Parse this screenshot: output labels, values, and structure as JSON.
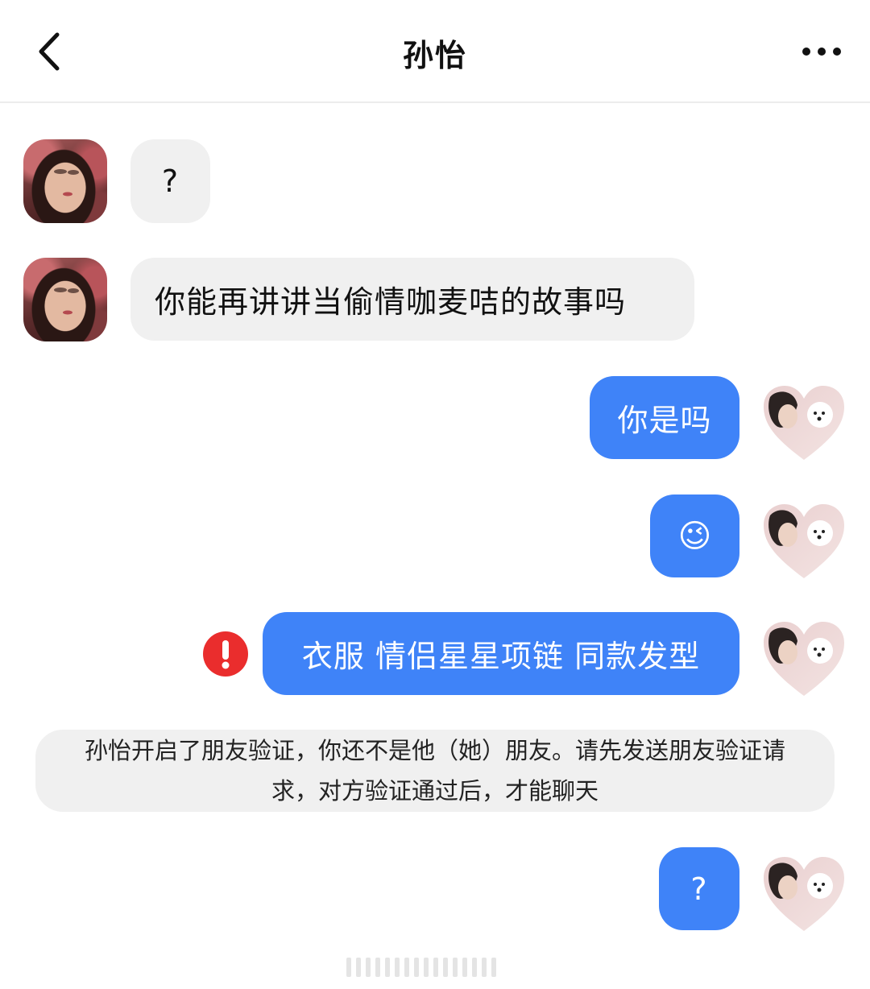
{
  "header": {
    "title": "孙怡",
    "back_icon": "chevron-left-icon",
    "more_icon": "more-horizontal-icon"
  },
  "messages": [
    {
      "side": "left",
      "text": "?"
    },
    {
      "side": "left",
      "text": "你能再讲讲当偷情咖麦咭的故事吗"
    },
    {
      "side": "right",
      "text": "你是吗"
    },
    {
      "side": "right",
      "text": "😉"
    },
    {
      "side": "right",
      "text": "衣服 情侣星星项链 同款发型",
      "status": "failed"
    },
    {
      "side": "right",
      "text": "?"
    }
  ],
  "system_notice": {
    "line1": "孙怡开启了朋友验证，你还不是他（她）朋友。请先发送朋友验证请",
    "line2": "求，对方验证通过后，才能聊天"
  },
  "colors": {
    "outgoing_bubble": "#3f83f8",
    "incoming_bubble": "#f0f0f0",
    "error_badge": "#ea2d2d"
  }
}
